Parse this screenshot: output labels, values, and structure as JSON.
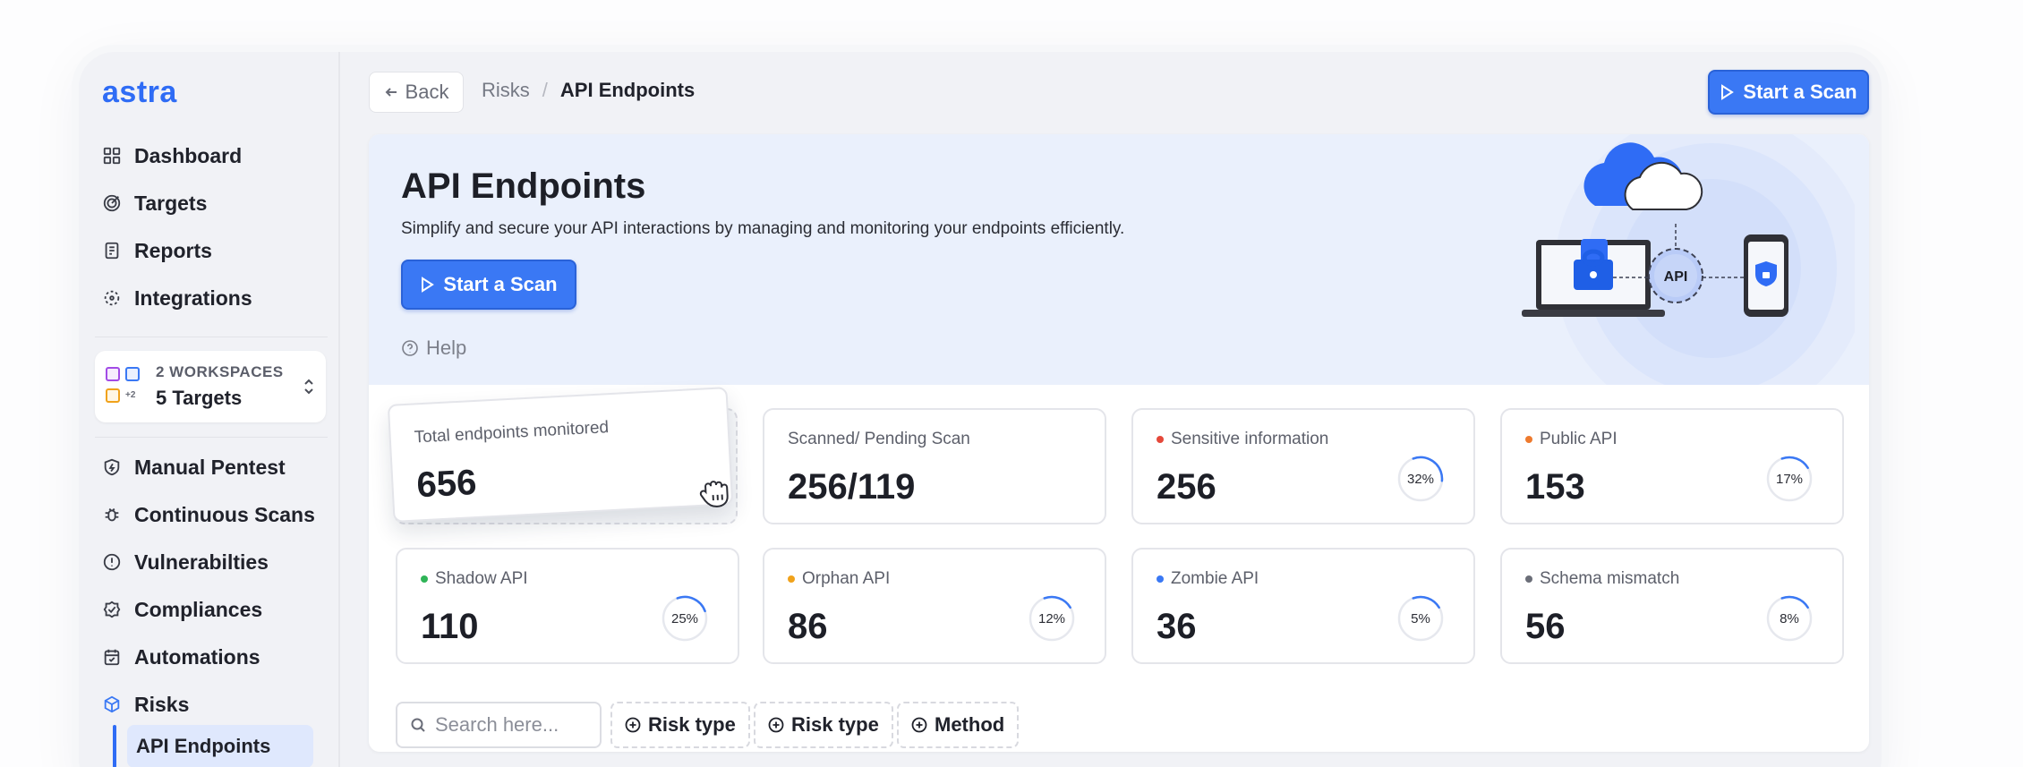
{
  "app": {
    "logo": "astra"
  },
  "sidebar": {
    "items": [
      {
        "label": "Dashboard",
        "icon": "grid-icon"
      },
      {
        "label": "Targets",
        "icon": "target-icon"
      },
      {
        "label": "Reports",
        "icon": "report-icon"
      },
      {
        "label": "Integrations",
        "icon": "integrations-icon"
      }
    ],
    "workspace": {
      "title": "2 WORKSPACES",
      "targets": "5 Targets",
      "extra": "+2"
    },
    "items2": [
      {
        "label": "Manual Pentest",
        "icon": "shield-bolt-icon"
      },
      {
        "label": "Continuous Scans",
        "icon": "bug-icon"
      },
      {
        "label": "Vulnerabilties",
        "icon": "alert-circle-icon"
      },
      {
        "label": "Compliances",
        "icon": "badge-check-icon"
      },
      {
        "label": "Automations",
        "icon": "calendar-icon"
      },
      {
        "label": "Risks",
        "icon": "cube-icon"
      }
    ],
    "sub_active": "API Endpoints"
  },
  "topbar": {
    "back": "Back",
    "breadcrumb": [
      "Risks",
      "/",
      "API Endpoints"
    ],
    "scan_button": "Start a Scan"
  },
  "hero": {
    "title": "API Endpoints",
    "subtitle": "Simplify and secure your API interactions by managing and monitoring your endpoints efficiently.",
    "scan_button": "Start a Scan",
    "help": "Help",
    "illustration_label": "API"
  },
  "stats": {
    "total": {
      "label": "Total endpoints monitored",
      "value": "656"
    },
    "scanned": {
      "label": "Scanned/ Pending Scan",
      "value": "256/119"
    },
    "sensitive": {
      "label": "Sensitive information",
      "value": "256",
      "percent": "32%",
      "fraction": 0.32,
      "color": "#e5483a"
    },
    "public": {
      "label": "Public API",
      "value": "153",
      "percent": "17%",
      "fraction": 0.17,
      "color": "#ee7a2e"
    },
    "shadow": {
      "label": "Shadow API",
      "value": "110",
      "percent": "25%",
      "fraction": 0.25,
      "color": "#2fb457"
    },
    "orphan": {
      "label": "Orphan API",
      "value": "86",
      "percent": "12%",
      "fraction": 0.12,
      "color": "#f0a21b"
    },
    "zombie": {
      "label": "Zombie API",
      "value": "36",
      "percent": "5%",
      "fraction": 0.05,
      "color": "#3a78f4"
    },
    "schema": {
      "label": "Schema mismatch",
      "value": "56",
      "percent": "8%",
      "fraction": 0.08,
      "color": "#6b6e78"
    }
  },
  "filters": {
    "search_placeholder": "Search here...",
    "chips": [
      "Risk type",
      "Risk type",
      "Method"
    ]
  },
  "colors": {
    "accent": "#3a78f4",
    "ring": "#3a78f4"
  }
}
